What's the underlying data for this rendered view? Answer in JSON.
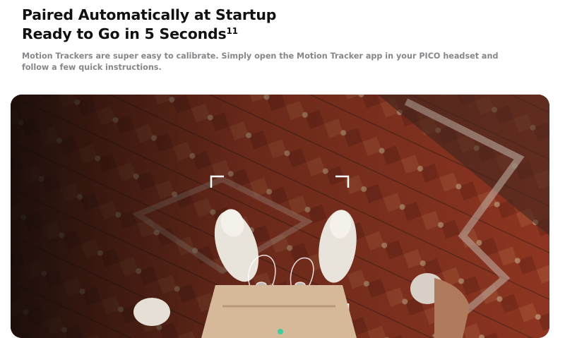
{
  "heading": {
    "line1": "Paired Automatically at Startup",
    "line2": "Ready to Go in 5 Seconds",
    "footnote": "11"
  },
  "description": "Motion Trackers are super easy to calibrate. Simply open the Motion Tracker app in your PICO headset and follow a few quick instructions.",
  "media": {
    "scene": "overhead-view-feet-on-persian-rug-with-calibration-frame",
    "colors": {
      "rug": "#9c3a24",
      "shadow": "#1e1410",
      "shoe": "#e8e4dc",
      "frame": "#ffffff",
      "accent": "#3ccf9a"
    }
  }
}
